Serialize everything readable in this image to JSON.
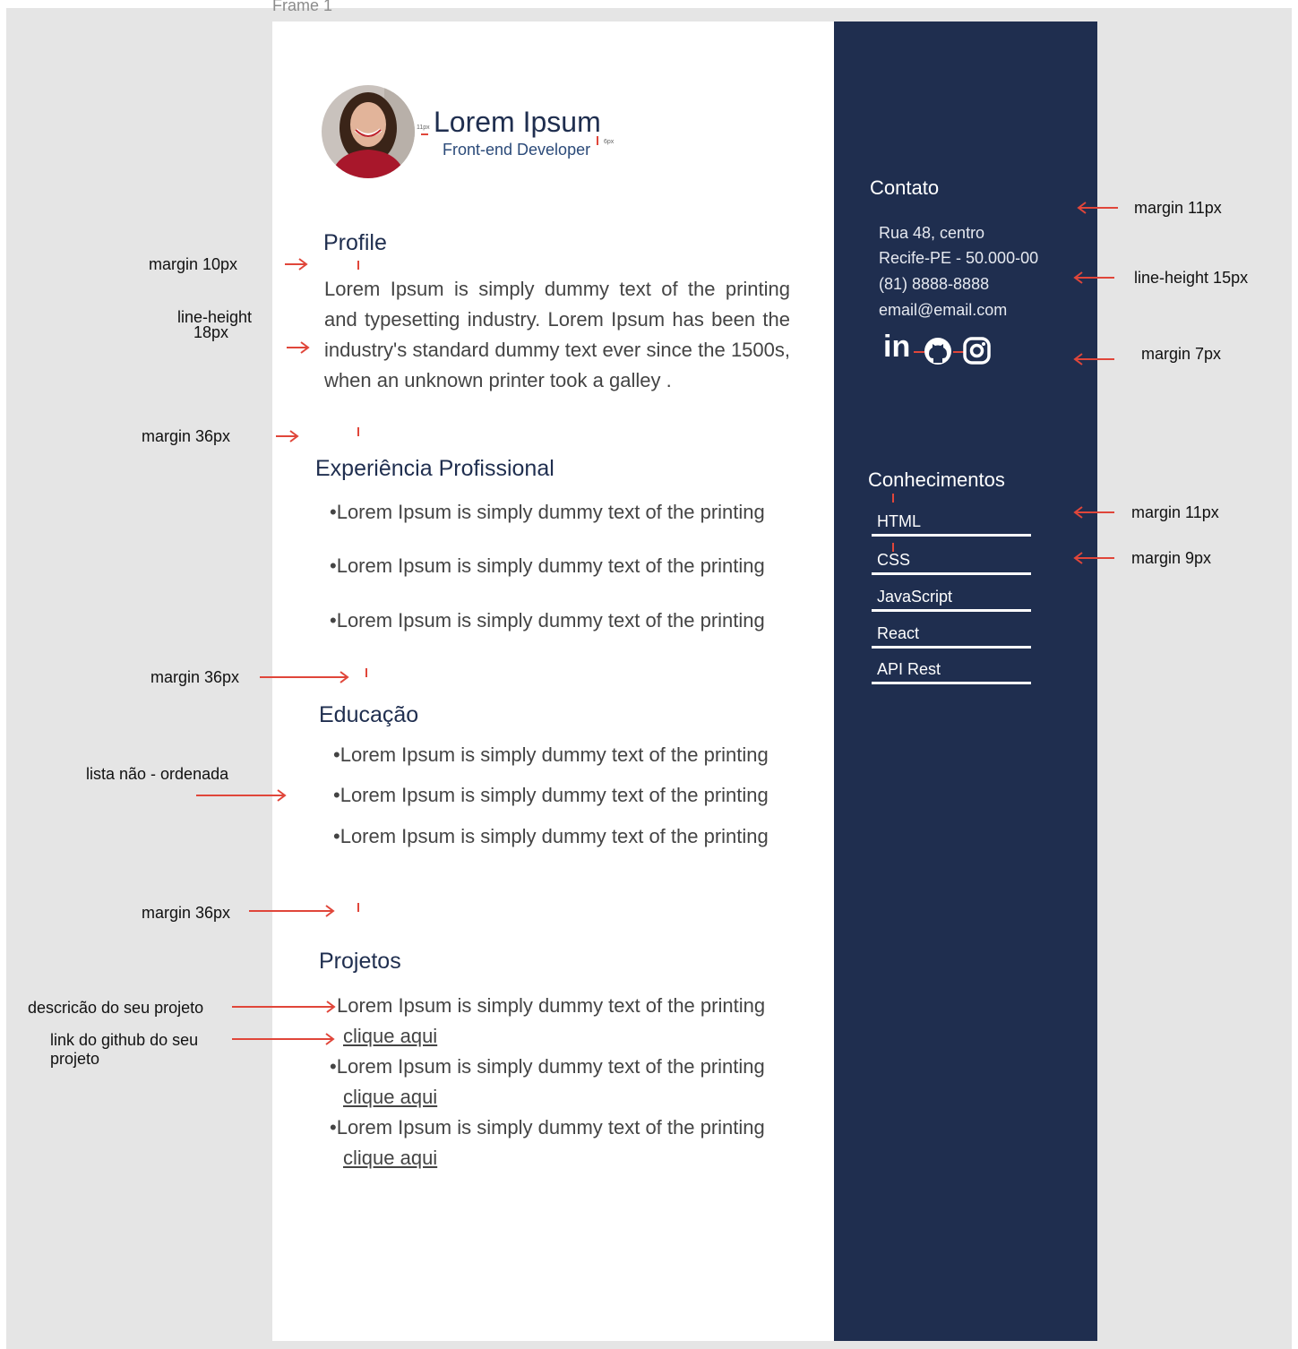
{
  "frame_label": "Frame 1",
  "header": {
    "name": "Lorem Ipsum",
    "role": "Front-end Developer",
    "spacing_note_1": "11px",
    "spacing_note_2": "6px"
  },
  "profile": {
    "title": "Profile",
    "text": "Lorem Ipsum is simply dummy text of the printing and typesetting industry. Lorem Ipsum has been the industry's standard dummy text ever since the 1500s, when an unknown printer took a galley ."
  },
  "experience": {
    "title": "Experiência Profissional",
    "items": [
      "•Lorem Ipsum is simply dummy text of the printing",
      "•Lorem Ipsum is simply dummy text of the printing",
      "•Lorem Ipsum is simply dummy text of the printing"
    ]
  },
  "education": {
    "title": "Educação",
    "items": [
      "•Lorem Ipsum is simply dummy text of the printing",
      "•Lorem Ipsum is simply dummy text of the printing",
      "•Lorem Ipsum is simply dummy text of the printing"
    ]
  },
  "projects": {
    "title": "Projetos",
    "items": [
      {
        "text": "Lorem Ipsum is simply dummy text of the printing",
        "link": "clique aqui"
      },
      {
        "text": "•Lorem Ipsum is simply dummy text of the printing",
        "link": "clique aqui"
      },
      {
        "text": "•Lorem Ipsum is simply dummy text of the printing",
        "link": "clique aqui"
      }
    ]
  },
  "contact": {
    "title": "Contato",
    "lines": [
      "Rua  48, centro",
      "Recife-PE - 50.000-00",
      "(81) 8888-8888",
      "email@email.com"
    ],
    "icons": [
      "linkedin-icon",
      "github-icon",
      "instagram-icon"
    ],
    "linkedin_text": "in"
  },
  "skills": {
    "title": "Conhecimentos",
    "items": [
      "HTML",
      "CSS",
      "JavaScript",
      "React",
      "API Rest"
    ]
  },
  "annotations": {
    "left": [
      "margin  10px",
      "line-height",
      "18px",
      "margin   36px",
      "margin   36px",
      "lista não - ordenada",
      "margin  36px",
      "descricão do seu projeto",
      "link do github do seu",
      "projeto"
    ],
    "right": [
      "margin  11px",
      "line-height  15px",
      "margin  7px",
      "margin  11px",
      "margin  9px"
    ]
  },
  "colors": {
    "sidebar": "#1f2e4f",
    "heading": "#1f2e4f",
    "annotation_arrow": "#e0463a",
    "canvas": "#e5e5e5"
  }
}
